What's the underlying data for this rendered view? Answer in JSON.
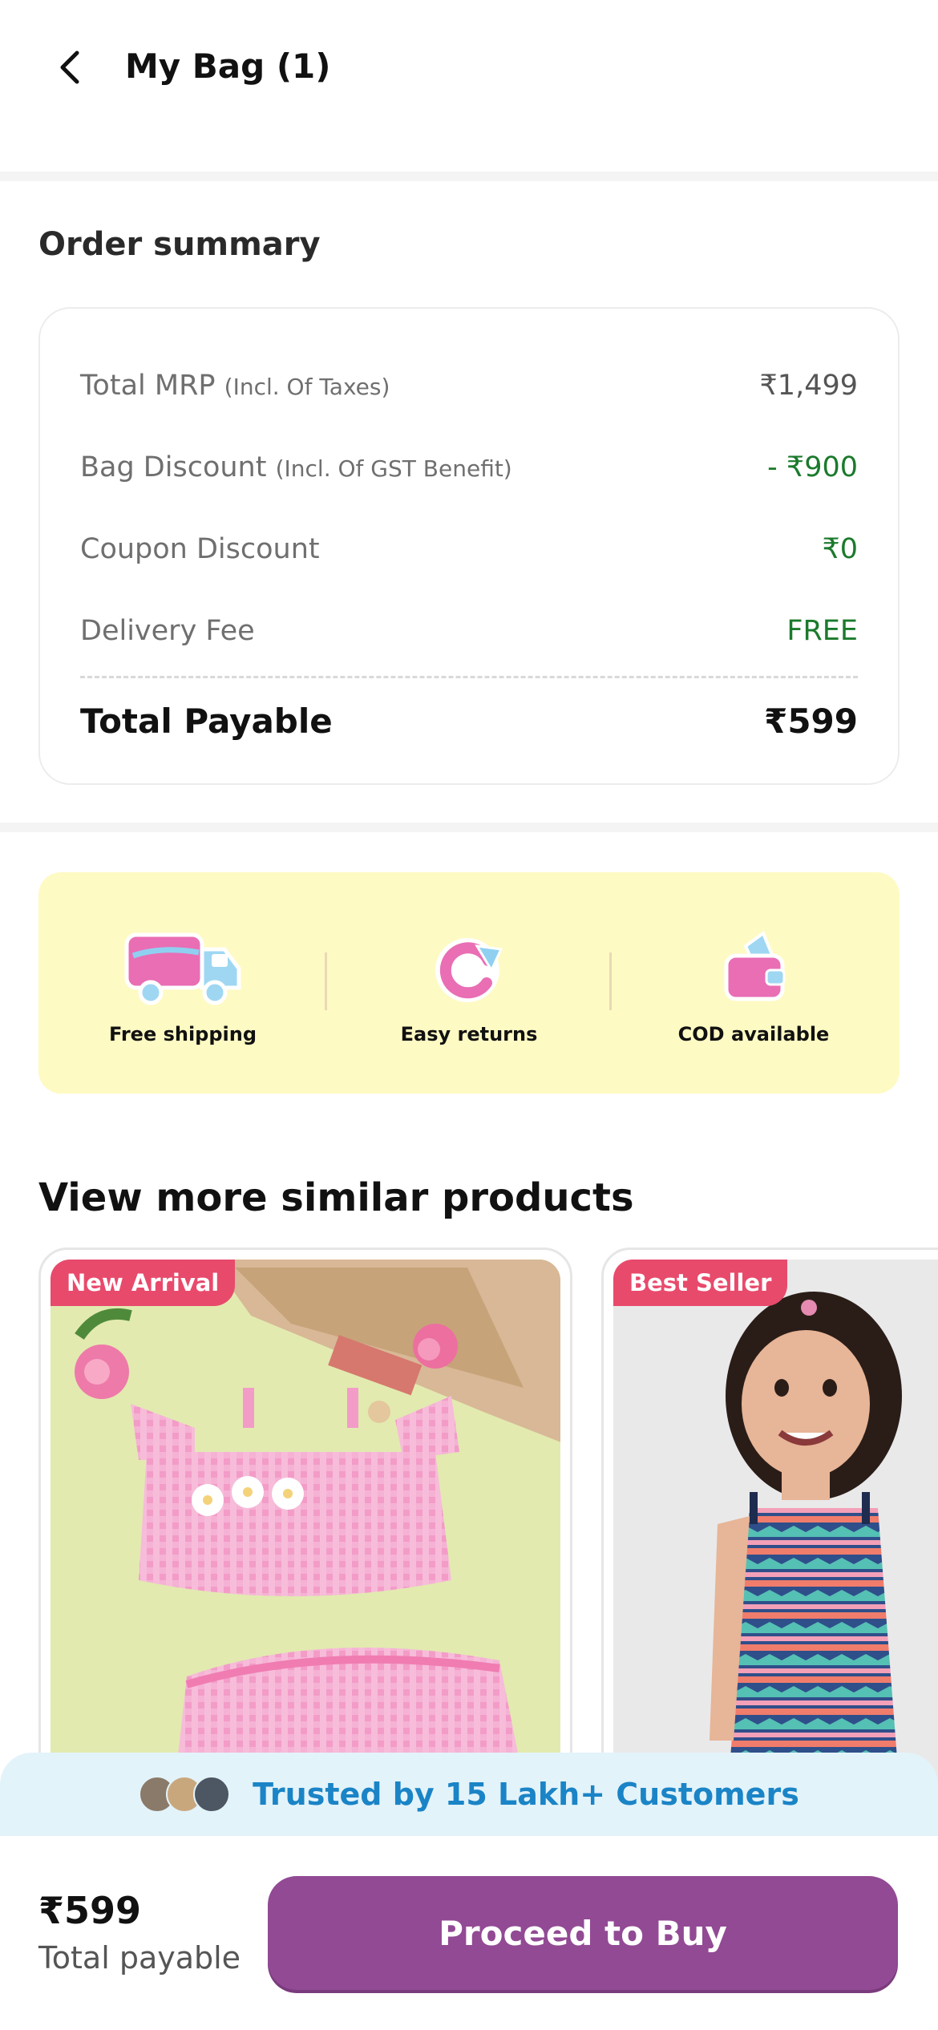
{
  "header": {
    "title": "My Bag (1)"
  },
  "order_summary": {
    "title": "Order summary",
    "rows": [
      {
        "label": "Total MRP",
        "sub": "(Incl. Of Taxes)",
        "value": "₹1,499"
      },
      {
        "label": "Bag Discount",
        "sub": "(Incl. Of GST Benefit)",
        "value": "- ₹900"
      },
      {
        "label": "Coupon Discount",
        "sub": "",
        "value": "₹0"
      },
      {
        "label": "Delivery Fee",
        "sub": "",
        "value": "FREE"
      }
    ],
    "total_label": "Total Payable",
    "total_value": "₹599"
  },
  "benefits": [
    {
      "label": "Free shipping",
      "icon": "truck-icon"
    },
    {
      "label": "Easy returns",
      "icon": "return-icon"
    },
    {
      "label": "COD available",
      "icon": "wallet-icon"
    }
  ],
  "similar": {
    "title": "View more similar products",
    "products": [
      {
        "badge": "New Arrival",
        "image": "pink-gingham-outfit-image"
      },
      {
        "badge": "Best Seller",
        "image": "girl-printed-jumpsuit-image"
      }
    ]
  },
  "trust": {
    "text": "Trusted by 15 Lakh+ Customers"
  },
  "footer": {
    "price": "₹599",
    "price_label": "Total payable",
    "cta": "Proceed to Buy"
  },
  "colors": {
    "accent": "#924a94",
    "discount_green": "#1b7a2c",
    "badge": "#e84a6c",
    "trust_text": "#1a84c6",
    "benefits_bg": "#fefac3"
  }
}
